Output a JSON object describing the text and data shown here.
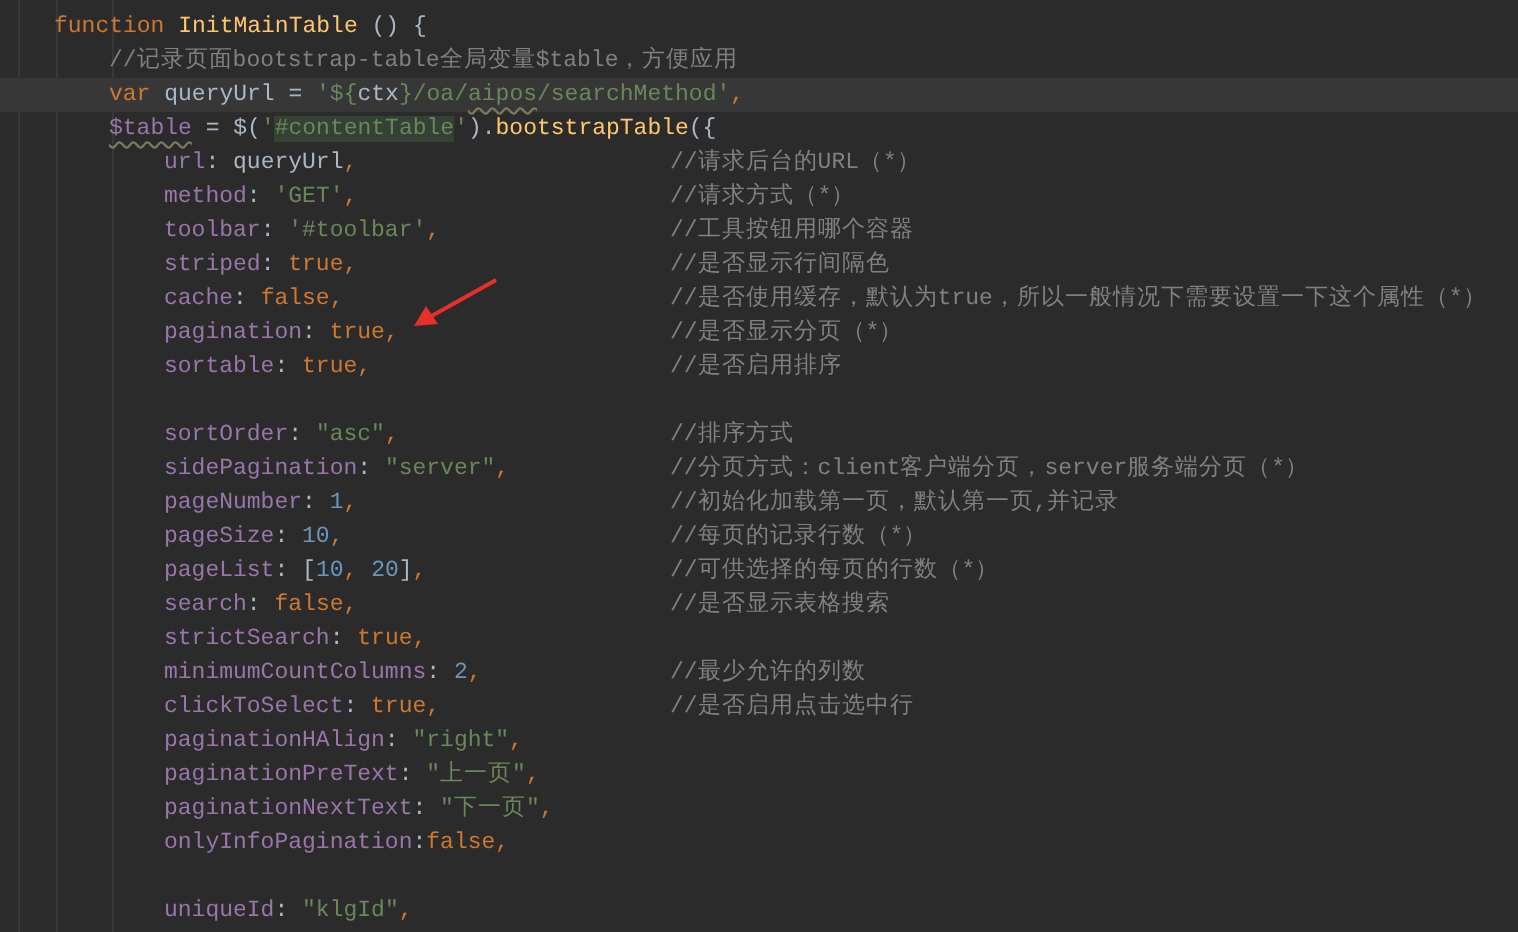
{
  "editor": {
    "lines": [
      {
        "current": false,
        "tokens": [
          {
            "kind": "keyword",
            "text": "function "
          },
          {
            "kind": "func",
            "text": "InitMainTable"
          },
          {
            "kind": "plain",
            "text": " () {"
          }
        ],
        "children": [
          {
            "current": false,
            "tokens": [
              {
                "kind": "comment",
                "text": "//记录页面bootstrap-table全局变量$table，方便应用"
              }
            ]
          },
          {
            "current": true,
            "tokens": [
              {
                "kind": "keyword",
                "text": "var "
              },
              {
                "kind": "plain",
                "text": "queryUrl = "
              },
              {
                "kind": "string",
                "text": "'${"
              },
              {
                "kind": "plain",
                "text": "ctx"
              },
              {
                "kind": "string",
                "text": "}/oa/"
              },
              {
                "kind": "string_typo",
                "text": "aipos"
              },
              {
                "kind": "string",
                "text": "/searchMethod'"
              },
              {
                "kind": "keyword",
                "text": ","
              }
            ]
          },
          {
            "current": false,
            "tokens": [
              {
                "kind": "var_typo",
                "text": "$table"
              },
              {
                "kind": "plain",
                "text": " = $("
              },
              {
                "kind": "string",
                "text": "'"
              },
              {
                "kind": "string_match",
                "text": "#contentTable"
              },
              {
                "kind": "string",
                "text": "'"
              },
              {
                "kind": "plain",
                "text": ")."
              },
              {
                "kind": "func",
                "text": "bootstrapTable"
              },
              {
                "kind": "plain",
                "text": "({"
              }
            ],
            "children": [
              {
                "current": false,
                "tokens": [
                  {
                    "kind": "prop",
                    "text": "url"
                  },
                  {
                    "kind": "plain",
                    "text": ": queryUrl"
                  },
                  {
                    "kind": "keyword",
                    "text": ","
                  }
                ],
                "comment": "//请求后台的URL（*）"
              },
              {
                "current": false,
                "tokens": [
                  {
                    "kind": "prop",
                    "text": "method"
                  },
                  {
                    "kind": "plain",
                    "text": ": "
                  },
                  {
                    "kind": "string",
                    "text": "'GET'"
                  },
                  {
                    "kind": "keyword",
                    "text": ","
                  }
                ],
                "comment": "//请求方式（*）"
              },
              {
                "current": false,
                "tokens": [
                  {
                    "kind": "prop",
                    "text": "toolbar"
                  },
                  {
                    "kind": "plain",
                    "text": ": "
                  },
                  {
                    "kind": "string",
                    "text": "'#toolbar'"
                  },
                  {
                    "kind": "keyword",
                    "text": ","
                  }
                ],
                "comment": "//工具按钮用哪个容器"
              },
              {
                "current": false,
                "tokens": [
                  {
                    "kind": "prop",
                    "text": "striped"
                  },
                  {
                    "kind": "plain",
                    "text": ": "
                  },
                  {
                    "kind": "keyword",
                    "text": "true,"
                  }
                ],
                "comment": "//是否显示行间隔色"
              },
              {
                "current": false,
                "tokens": [
                  {
                    "kind": "prop",
                    "text": "cache"
                  },
                  {
                    "kind": "plain",
                    "text": ": "
                  },
                  {
                    "kind": "keyword",
                    "text": "false,"
                  }
                ],
                "comment": "//是否使用缓存，默认为true，所以一般情况下需要设置一下这个属性（*）"
              },
              {
                "current": false,
                "tokens": [
                  {
                    "kind": "prop",
                    "text": "pagination"
                  },
                  {
                    "kind": "plain",
                    "text": ": "
                  },
                  {
                    "kind": "keyword",
                    "text": "true,"
                  }
                ],
                "comment": "//是否显示分页（*）"
              },
              {
                "current": false,
                "tokens": [
                  {
                    "kind": "prop",
                    "text": "sortable"
                  },
                  {
                    "kind": "plain",
                    "text": ": "
                  },
                  {
                    "kind": "keyword",
                    "text": "true,"
                  }
                ],
                "comment": "//是否启用排序"
              },
              {
                "current": false
              },
              {
                "current": false,
                "tokens": [
                  {
                    "kind": "prop",
                    "text": "sortOrder"
                  },
                  {
                    "kind": "plain",
                    "text": ": "
                  },
                  {
                    "kind": "string",
                    "text": "\"asc\""
                  },
                  {
                    "kind": "keyword",
                    "text": ","
                  }
                ],
                "comment": "//排序方式"
              },
              {
                "current": false,
                "tokens": [
                  {
                    "kind": "prop",
                    "text": "sidePagination"
                  },
                  {
                    "kind": "plain",
                    "text": ": "
                  },
                  {
                    "kind": "string",
                    "text": "\"server\""
                  },
                  {
                    "kind": "keyword",
                    "text": ","
                  }
                ],
                "comment": "//分页方式：client客户端分页，server服务端分页（*）"
              },
              {
                "current": false,
                "tokens": [
                  {
                    "kind": "prop",
                    "text": "pageNumber"
                  },
                  {
                    "kind": "plain",
                    "text": ": "
                  },
                  {
                    "kind": "number",
                    "text": "1"
                  },
                  {
                    "kind": "keyword",
                    "text": ","
                  }
                ],
                "comment": "//初始化加载第一页，默认第一页,并记录"
              },
              {
                "current": false,
                "tokens": [
                  {
                    "kind": "prop",
                    "text": "pageSize"
                  },
                  {
                    "kind": "plain",
                    "text": ": "
                  },
                  {
                    "kind": "number",
                    "text": "10"
                  },
                  {
                    "kind": "keyword",
                    "text": ","
                  }
                ],
                "comment": "//每页的记录行数（*）"
              },
              {
                "current": false,
                "tokens": [
                  {
                    "kind": "prop",
                    "text": "pageList"
                  },
                  {
                    "kind": "plain",
                    "text": ": ["
                  },
                  {
                    "kind": "number",
                    "text": "10"
                  },
                  {
                    "kind": "keyword",
                    "text": ", "
                  },
                  {
                    "kind": "number",
                    "text": "20"
                  },
                  {
                    "kind": "plain",
                    "text": "]"
                  },
                  {
                    "kind": "keyword",
                    "text": ","
                  }
                ],
                "comment": "//可供选择的每页的行数（*）"
              },
              {
                "current": false,
                "tokens": [
                  {
                    "kind": "prop",
                    "text": "search"
                  },
                  {
                    "kind": "plain",
                    "text": ": "
                  },
                  {
                    "kind": "keyword",
                    "text": "false,"
                  }
                ],
                "comment": "//是否显示表格搜索"
              },
              {
                "current": false,
                "tokens": [
                  {
                    "kind": "prop",
                    "text": "strictSearch"
                  },
                  {
                    "kind": "plain",
                    "text": ": "
                  },
                  {
                    "kind": "keyword",
                    "text": "true,"
                  }
                ]
              },
              {
                "current": false,
                "tokens": [
                  {
                    "kind": "prop",
                    "text": "minimumCountColumns"
                  },
                  {
                    "kind": "plain",
                    "text": ": "
                  },
                  {
                    "kind": "number",
                    "text": "2"
                  },
                  {
                    "kind": "keyword",
                    "text": ","
                  }
                ],
                "comment": "//最少允许的列数"
              },
              {
                "current": false,
                "tokens": [
                  {
                    "kind": "prop",
                    "text": "clickToSelect"
                  },
                  {
                    "kind": "plain",
                    "text": ": "
                  },
                  {
                    "kind": "keyword",
                    "text": "true,"
                  }
                ],
                "comment": "//是否启用点击选中行"
              },
              {
                "current": false,
                "tokens": [
                  {
                    "kind": "prop",
                    "text": "paginationHAlign"
                  },
                  {
                    "kind": "plain",
                    "text": ": "
                  },
                  {
                    "kind": "string",
                    "text": "\"right\""
                  },
                  {
                    "kind": "keyword",
                    "text": ","
                  }
                ]
              },
              {
                "current": false,
                "tokens": [
                  {
                    "kind": "prop",
                    "text": "paginationPreText"
                  },
                  {
                    "kind": "plain",
                    "text": ": "
                  },
                  {
                    "kind": "string",
                    "text": "\"上一页\""
                  },
                  {
                    "kind": "keyword",
                    "text": ","
                  }
                ]
              },
              {
                "current": false,
                "tokens": [
                  {
                    "kind": "prop",
                    "text": "paginationNextText"
                  },
                  {
                    "kind": "plain",
                    "text": ": "
                  },
                  {
                    "kind": "string",
                    "text": "\"下一页\""
                  },
                  {
                    "kind": "keyword",
                    "text": ","
                  }
                ]
              },
              {
                "current": false,
                "tokens": [
                  {
                    "kind": "prop",
                    "text": "onlyInfoPagination"
                  },
                  {
                    "kind": "plain",
                    "text": ":"
                  },
                  {
                    "kind": "keyword",
                    "text": "false,"
                  }
                ]
              },
              {
                "current": false
              },
              {
                "current": false,
                "tokens": [
                  {
                    "kind": "prop",
                    "text": "uniqueId"
                  },
                  {
                    "kind": "plain",
                    "text": ": "
                  },
                  {
                    "kind": "string",
                    "text": "\"klgId\""
                  },
                  {
                    "kind": "keyword",
                    "text": ","
                  }
                ]
              }
            ]
          }
        ]
      }
    ]
  }
}
